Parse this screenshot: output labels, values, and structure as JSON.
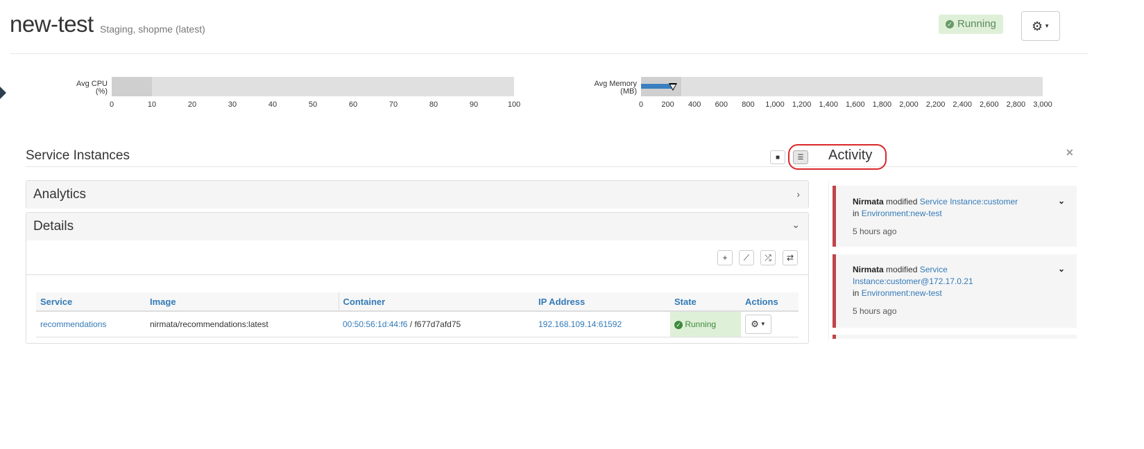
{
  "header": {
    "title": "new-test",
    "subtitle": "Staging, shopme (latest)",
    "status": "Running"
  },
  "gauges": {
    "cpu": {
      "label_line1": "Avg CPU",
      "label_line2": "(%)",
      "ticks": [
        "0",
        "10",
        "20",
        "30",
        "40",
        "50",
        "60",
        "70",
        "80",
        "90",
        "100"
      ],
      "range": [
        0,
        100
      ],
      "band": [
        0,
        10
      ]
    },
    "memory": {
      "label_line1": "Avg Memory",
      "label_line2": "(MB)",
      "ticks": [
        "0",
        "200",
        "400",
        "600",
        "800",
        "1,000",
        "1,200",
        "1,400",
        "1,600",
        "1,800",
        "2,000",
        "2,200",
        "2,400",
        "2,600",
        "2,800",
        "3,000"
      ],
      "range": [
        0,
        3000
      ],
      "band": [
        0,
        300
      ],
      "value": 240,
      "marker": 240
    }
  },
  "main": {
    "section_title": "Service Instances",
    "panels": {
      "analytics": "Analytics",
      "details": "Details"
    },
    "table": {
      "headers": [
        "Service",
        "Image",
        "Container",
        "IP Address",
        "State",
        "Actions"
      ],
      "rows": [
        {
          "service": "recommendations",
          "image": "nirmata/recommendations:latest",
          "container_link": "00:50:56:1d:44:f6",
          "container_sep": " / ",
          "container_id": "f677d7afd75",
          "ip": "192.168.109.14:61592",
          "state": "Running"
        }
      ]
    }
  },
  "activity": {
    "title": "Activity",
    "items": [
      {
        "actor": "Nirmata",
        "verb": "modified",
        "target": "Service Instance:customer",
        "in_word": "in",
        "context": "Environment:new-test",
        "time": "5 hours ago"
      },
      {
        "actor": "Nirmata",
        "verb": "modified",
        "target_line1": "Service",
        "target_line2": "Instance:customer@172.17.0.21",
        "in_word": "in",
        "context": "Environment:new-test",
        "time": "5 hours ago"
      }
    ]
  },
  "colors": {
    "accent": "#337ab7",
    "running_bg": "#dff0d8",
    "activity_border": "#c0454c",
    "highlight_ring": "#d9262a",
    "memory_bar": "#3b7fc0"
  }
}
